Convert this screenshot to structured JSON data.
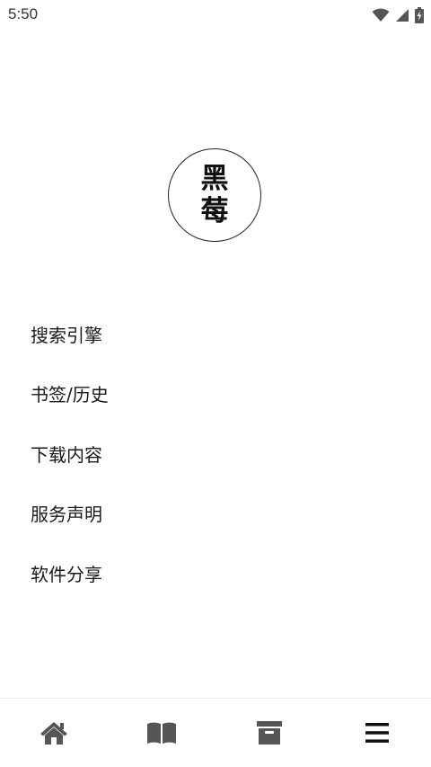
{
  "status_bar": {
    "time": "5:50",
    "icons": [
      "wifi-icon",
      "cell-signal-icon",
      "battery-charging-icon"
    ]
  },
  "logo": {
    "line1": "黑",
    "line2": "莓"
  },
  "menu": {
    "items": [
      {
        "label": "搜索引擎"
      },
      {
        "label": "书签/历史"
      },
      {
        "label": "下载内容"
      },
      {
        "label": "服务声明"
      },
      {
        "label": "软件分享"
      }
    ]
  },
  "bottom_nav": {
    "tabs": [
      {
        "icon": "home-icon"
      },
      {
        "icon": "book-icon"
      },
      {
        "icon": "archive-box-icon"
      },
      {
        "icon": "menu-icon",
        "active": true
      }
    ],
    "colors": {
      "inactive": "#555555",
      "active": "#111111"
    }
  }
}
